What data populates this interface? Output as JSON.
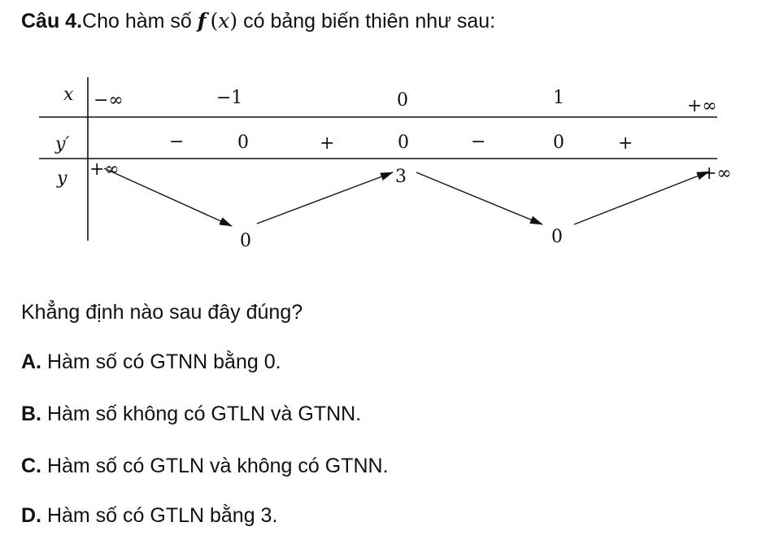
{
  "question": {
    "label": "Câu 4.",
    "text_before": "Cho hàm số ",
    "func_name": "f",
    "func_var": "x",
    "text_after": " có bảng biến thiên như sau:"
  },
  "table": {
    "row_x_label": "x",
    "row_yp_label": "y′",
    "row_y_label": "y",
    "x_values": [
      "−∞",
      "−1",
      "0",
      "1",
      "+∞"
    ],
    "yp_signs": [
      "−",
      "0",
      "+",
      "0",
      "−",
      "0",
      "+"
    ],
    "y_values": {
      "left": "+∞",
      "min1": "0",
      "max": "3",
      "min2": "0",
      "right": "+∞"
    }
  },
  "prompt": "Khẳng định nào sau đây đúng?",
  "options": [
    {
      "letter": "A.",
      "text": " Hàm số có GTNN bằng 0."
    },
    {
      "letter": "B.",
      "text": " Hàm số không có GTLN và GTNN."
    },
    {
      "letter": "C.",
      "text": " Hàm số có GTLN và không có GTNN."
    },
    {
      "letter": "D.",
      "text": " Hàm số có GTLN bằng 3."
    }
  ]
}
